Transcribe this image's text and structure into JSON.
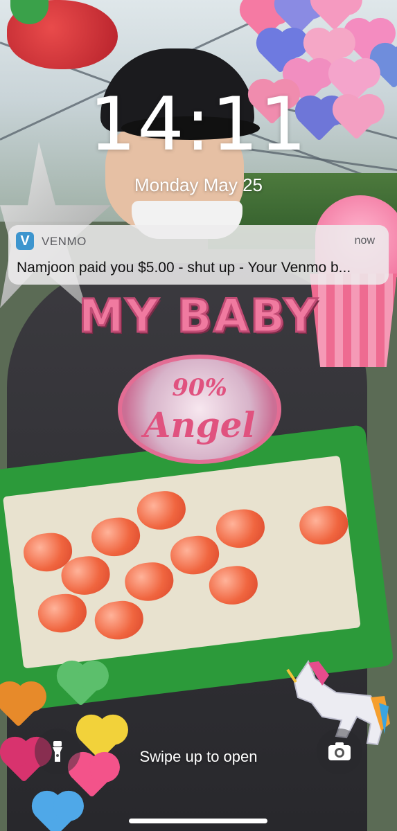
{
  "lockscreen": {
    "time": "14:11",
    "date": "Monday May 25",
    "swipe_hint": "Swipe up to open"
  },
  "notification": {
    "app_icon_letter": "V",
    "app_name": "VENMO",
    "time": "now",
    "body": "Namjoon paid you $5.00 - shut up - Your Venmo b..."
  },
  "wallpaper": {
    "sticker_text_main": "MY BABY",
    "badge_line_1": "90%",
    "badge_line_2": "Angel"
  },
  "quick_actions": {
    "left_icon": "flashlight-icon",
    "right_icon": "camera-icon"
  },
  "colors": {
    "venmo_blue": "#3d95ce",
    "sticker_pink": "#f07aa0",
    "tray_green": "#2c9a3a"
  }
}
